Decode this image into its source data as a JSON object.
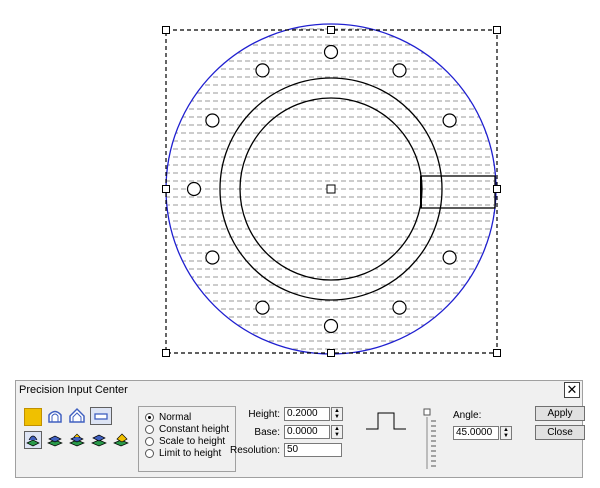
{
  "panel": {
    "title": "Precision Input Center",
    "close_label": "✕",
    "modes": [
      {
        "label": "Normal",
        "selected": true
      },
      {
        "label": "Constant height",
        "selected": false
      },
      {
        "label": "Scale to height",
        "selected": false
      },
      {
        "label": "Limit to height",
        "selected": false
      }
    ],
    "fields": {
      "height": {
        "label": "Height:",
        "value": "0.2000"
      },
      "base": {
        "label": "Base:",
        "value": "0.0000"
      },
      "resolution": {
        "label": "Resolution:",
        "value": "50"
      },
      "angle": {
        "label": "Angle:",
        "value": "45.0000"
      }
    },
    "apply_label": "Apply",
    "close_button_label": "Close"
  },
  "colors": {
    "outline_circle": "#2020d0",
    "hatch": "#9a9a9a",
    "tool_yellow": "#f0c000",
    "tool_blue": "#4060c0"
  },
  "icons": [
    "square-color-icon",
    "dome-icon",
    "house-icon",
    "rectangle-icon",
    "layer-tool-1-icon",
    "layer-tool-2-icon",
    "layer-tool-3-icon",
    "layer-tool-4-icon",
    "layer-tool-5-icon"
  ]
}
